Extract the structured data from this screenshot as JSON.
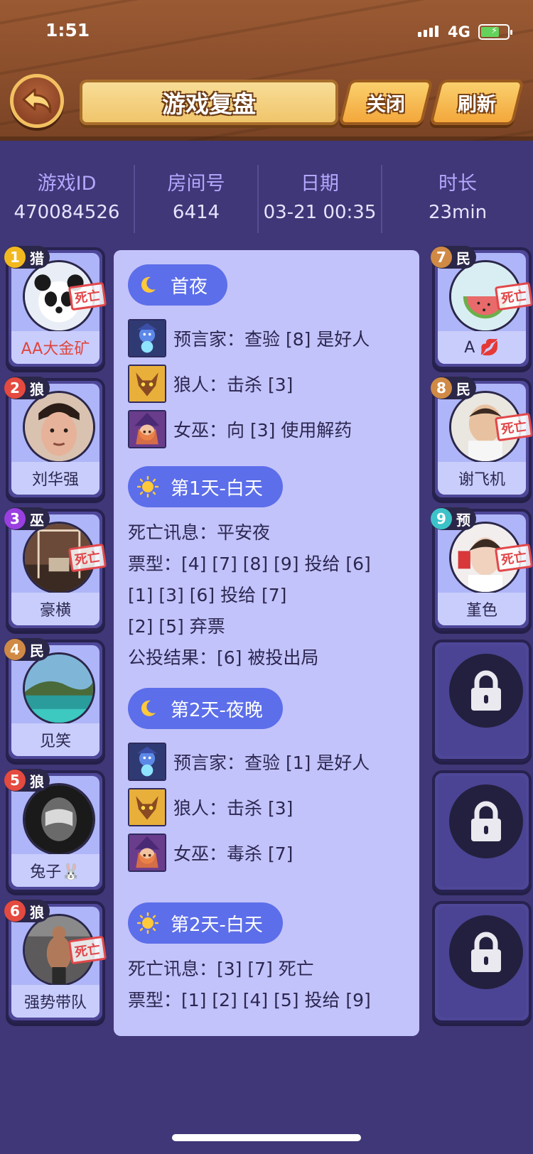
{
  "status_bar": {
    "time": "1:51",
    "network": "4G"
  },
  "header": {
    "title": "游戏复盘",
    "close_label": "关闭",
    "refresh_label": "刷新"
  },
  "game_info": [
    {
      "label": "游戏ID",
      "value": "470084526"
    },
    {
      "label": "房间号",
      "value": "6414"
    },
    {
      "label": "日期",
      "value": "03-21 00:35"
    },
    {
      "label": "时长",
      "value": "23min"
    }
  ],
  "players_left": [
    {
      "num": "1",
      "role": "猎",
      "name": "AA大金矿",
      "dead": true,
      "name_color": "#e0453d",
      "num_color": "#f2b81f",
      "avatar": "panda"
    },
    {
      "num": "2",
      "role": "狼",
      "name": "刘华强",
      "dead": false,
      "num_color": "#e44a3f",
      "avatar": "face"
    },
    {
      "num": "3",
      "role": "巫",
      "name": "豪横",
      "dead": true,
      "num_color": "#9a3fe0",
      "avatar": "swing"
    },
    {
      "num": "4",
      "role": "民",
      "name": "见笑",
      "dead": false,
      "num_color": "#d08a45",
      "avatar": "sea"
    },
    {
      "num": "5",
      "role": "狼",
      "name": "兔子🐰",
      "dead": false,
      "num_color": "#e44a3f",
      "avatar": "dark"
    },
    {
      "num": "6",
      "role": "狼",
      "name": "强势带队",
      "dead": true,
      "num_color": "#e44a3f",
      "avatar": "gym"
    }
  ],
  "players_right": [
    {
      "num": "7",
      "role": "民",
      "name": "A 💋",
      "dead": true,
      "num_color": "#d08a45",
      "avatar": "melon"
    },
    {
      "num": "8",
      "role": "民",
      "name": "谢飞机",
      "dead": true,
      "num_color": "#d08a45",
      "avatar": "kid"
    },
    {
      "num": "9",
      "role": "预",
      "name": "堇色",
      "dead": true,
      "num_color": "#3ec2c9",
      "avatar": "boy"
    }
  ],
  "dead_label": "死亡",
  "log": {
    "first_night": {
      "title": "首夜",
      "actions": [
        {
          "icon": "seer-icon",
          "text": "预言家：查验 [8] 是好人"
        },
        {
          "icon": "werewolf-icon",
          "text": "狼人：击杀 [3]"
        },
        {
          "icon": "witch-icon",
          "text": "女巫：向 [3] 使用解药"
        }
      ]
    },
    "day1": {
      "title": "第1天-白天",
      "lines": [
        "死亡讯息：平安夜",
        "票型：[4] [7] [8] [9] 投给 [6]",
        "[1] [3] [6] 投给 [7]",
        "[2] [5] 弃票",
        "公投结果：[6] 被投出局"
      ]
    },
    "night2": {
      "title": "第2天-夜晚",
      "actions": [
        {
          "icon": "seer-icon",
          "text": "预言家：查验 [1] 是好人"
        },
        {
          "icon": "werewolf-icon",
          "text": "狼人：击杀 [3]"
        },
        {
          "icon": "witch-icon",
          "text": "女巫：毒杀 [7]"
        }
      ]
    },
    "day2": {
      "title": "第2天-白天",
      "lines": [
        "死亡讯息：[3] [7] 死亡",
        "票型：[1] [2] [4] [5] 投给 [9]"
      ]
    }
  }
}
